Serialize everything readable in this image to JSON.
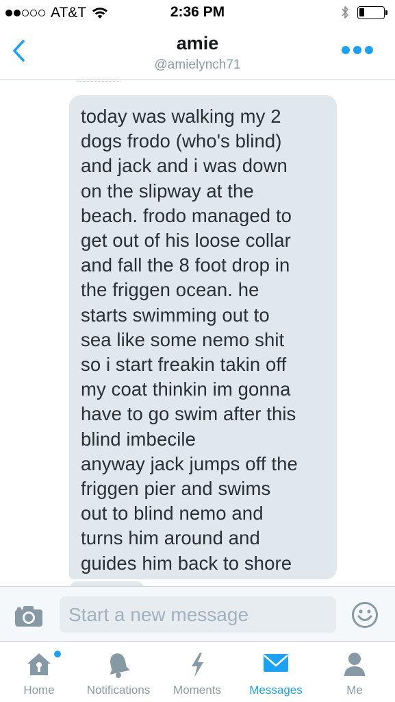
{
  "status_bar": {
    "carrier": "AT&T",
    "time": "2:36 PM",
    "signal_bars_filled": 2,
    "signal_bars_total": 5,
    "battery_level": 0.2,
    "icons": [
      "wifi-icon",
      "bluetooth-icon",
      "battery-icon"
    ]
  },
  "header": {
    "name": "amie",
    "handle": "@amielynch71",
    "back_icon": "chevron-left-icon",
    "more_icon": "more-dots-icon"
  },
  "conversation": {
    "messages": [
      {
        "sender": "amie",
        "text": "today was walking my 2\ndogs frodo (who's blind)\nand jack and i was down\non the slipway at the\nbeach. frodo managed to\nget out of his loose collar\nand fall the 8 foot drop in\nthe friggen ocean. he\nstarts swimming out to\nsea like some nemo shit\nso i start freakin takin off\nmy coat thinkin im gonna\nhave to go swim after this\nblind imbecile\nanyway jack jumps off the\nfriggen pier and swims\nout to blind nemo and\nturns him around and\nguides him back to shore"
      }
    ]
  },
  "composer": {
    "placeholder": "Start a new message",
    "value": "",
    "camera_icon": "camera-icon",
    "emoji_icon": "smiley-icon"
  },
  "tabbar": {
    "tabs": [
      {
        "label": "Home",
        "icon": "home-icon",
        "active": false,
        "has_notification": true
      },
      {
        "label": "Notifications",
        "icon": "bell-icon",
        "active": false,
        "has_notification": false
      },
      {
        "label": "Moments",
        "icon": "lightning-icon",
        "active": false,
        "has_notification": false
      },
      {
        "label": "Messages",
        "icon": "envelope-icon",
        "active": true,
        "has_notification": false
      },
      {
        "label": "Me",
        "icon": "person-icon",
        "active": false,
        "has_notification": false
      }
    ]
  },
  "colors": {
    "accent": "#1da1f2",
    "inactive_icon": "#8899a6",
    "bubble": "#e1e8ed",
    "text": "#292f33"
  }
}
